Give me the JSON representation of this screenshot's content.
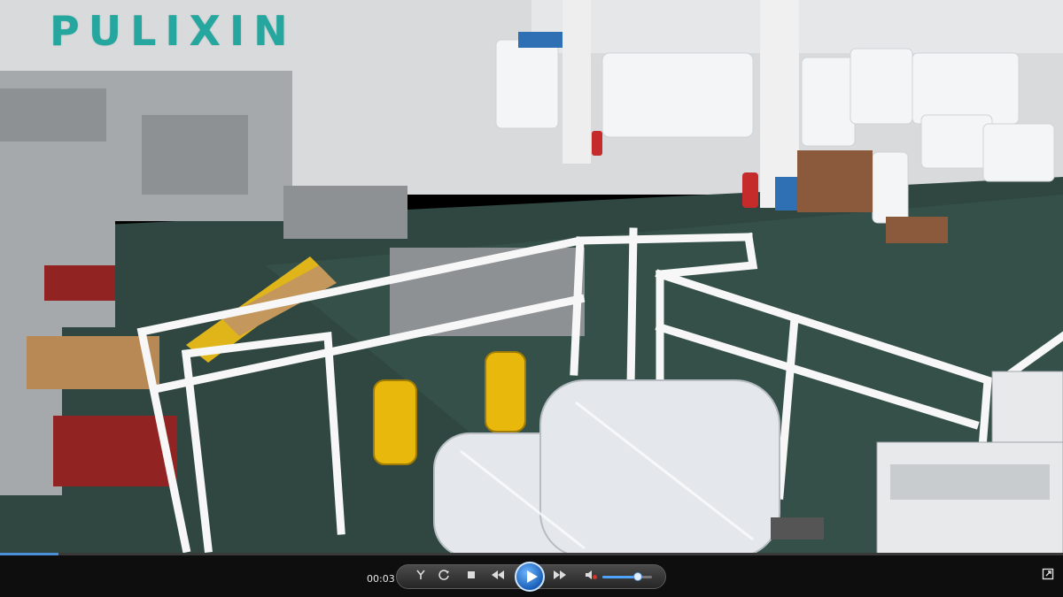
{
  "video": {
    "watermark": "PULIXIN",
    "scene_icon": "factory-scene-icon"
  },
  "controls": {
    "time": "00:03",
    "progress_fraction": 0.055,
    "volume_fraction": 0.72,
    "accent_color": "#4a90d9",
    "buttons": {
      "tools_icon": "tools-icon",
      "repeat_icon": "repeat-icon",
      "stop_icon": "stop-icon",
      "rewind_icon": "rewind-icon",
      "play_icon": "play-icon",
      "fast_forward_icon": "fast-forward-icon",
      "mute_icon": "volume-icon",
      "fullscreen_icon": "fullscreen-icon"
    }
  }
}
